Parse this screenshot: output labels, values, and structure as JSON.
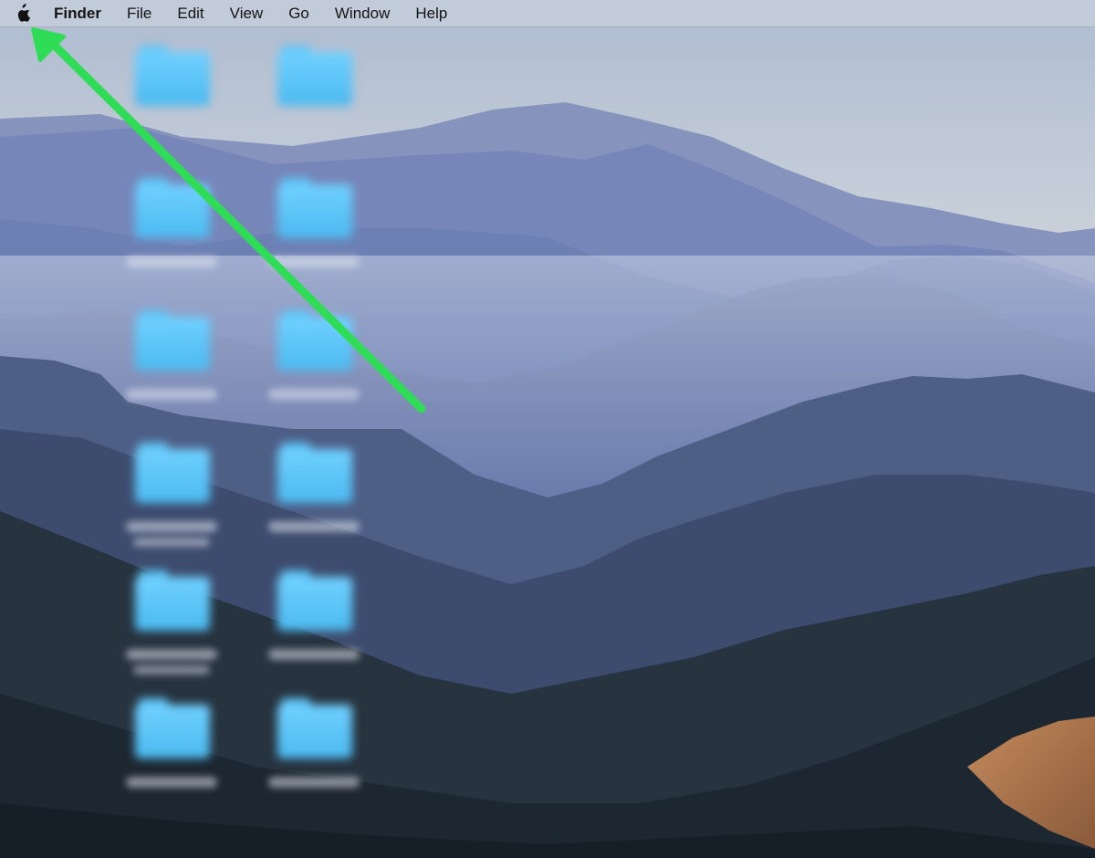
{
  "menubar": {
    "apple_icon": "apple-logo-icon",
    "app_name": "Finder",
    "items": [
      "File",
      "Edit",
      "View",
      "Go",
      "Window",
      "Help"
    ]
  },
  "desktop": {
    "icon_count": 12,
    "icon_type": "folder-icon",
    "labels_blurred": true
  },
  "annotation": {
    "type": "arrow",
    "color": "#2fdc55",
    "points_to": "apple-menu"
  },
  "colors": {
    "menubar": "#c4cdda",
    "folder": "#5cc6f7",
    "sky": "#c3ccd8",
    "mountain_far": "#6a7db0",
    "mountain_near": "#1e2a34",
    "dry_slope": "#b5805a"
  }
}
